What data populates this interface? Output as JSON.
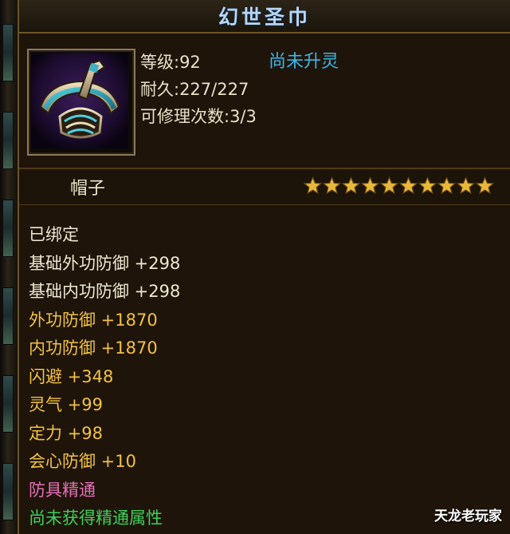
{
  "item": {
    "name": "幻世圣巾",
    "level": "等级:92",
    "durability": "耐久:227/227",
    "repair_count": "可修理次数:3/3",
    "spirit_status": "尚未升灵",
    "type": "帽子",
    "star_count": 10,
    "icon": "helmet-icon"
  },
  "attributes": [
    {
      "text": "已绑定",
      "color": "white"
    },
    {
      "text": "基础外功防御 +298",
      "color": "white"
    },
    {
      "text": "基础内功防御 +298",
      "color": "white"
    },
    {
      "text": "外功防御 +1870",
      "color": "gold"
    },
    {
      "text": "内功防御 +1870",
      "color": "gold"
    },
    {
      "text": "闪避 +348",
      "color": "gold"
    },
    {
      "text": "灵气 +99",
      "color": "gold"
    },
    {
      "text": "定力 +98",
      "color": "gold"
    },
    {
      "text": "会心防御 +10",
      "color": "gold"
    },
    {
      "text": "防具精通",
      "color": "pink"
    },
    {
      "text": "尚未获得精通属性",
      "color": "green"
    }
  ],
  "watermark": "天龙老玩家",
  "colors": {
    "title": "#b9d6ef",
    "spirit": "#3cb7e6",
    "white": "#ede8d2",
    "gold": "#f2c245",
    "pink": "#e76fb9",
    "green": "#3fd05c"
  }
}
